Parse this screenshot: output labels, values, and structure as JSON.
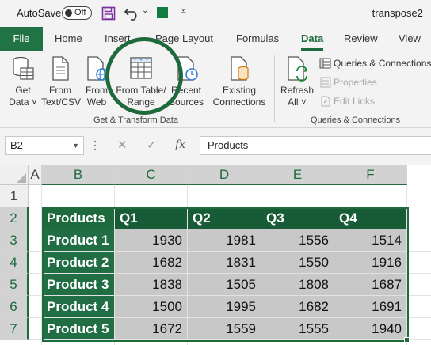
{
  "titlebar": {
    "autosave_label": "AutoSave",
    "autosave_state": "Off",
    "doc_title": "transpose2",
    "save_icon": "save-icon",
    "undo_icon": "undo-icon"
  },
  "tabs": [
    {
      "label": "File"
    },
    {
      "label": "Home"
    },
    {
      "label": "Insert"
    },
    {
      "label": "Page Layout"
    },
    {
      "label": "Formulas"
    },
    {
      "label": "Data"
    },
    {
      "label": "Review"
    },
    {
      "label": "View"
    }
  ],
  "ribbon": {
    "get_data": {
      "line1": "Get",
      "line2": "Data ˅"
    },
    "from_text_csv": {
      "line1": "From",
      "line2": "Text/CSV"
    },
    "from_web": {
      "line1": "From",
      "line2": "Web"
    },
    "from_table_range": {
      "line1": "From Table/",
      "line2": "Range"
    },
    "recent_sources": {
      "line1": "Recent",
      "line2": "Sources"
    },
    "existing_connections": {
      "line1": "Existing",
      "line2": "Connections"
    },
    "group_get_transform": "Get & Transform Data",
    "refresh_all": {
      "line1": "Refresh",
      "line2": "All ˅"
    },
    "queries_connections": "Queries & Connections",
    "properties": "Properties",
    "edit_links": "Edit Links",
    "group_queries": "Queries & Connections"
  },
  "formula_bar": {
    "name_box": "B2",
    "cancel_symbol": "✕",
    "enter_symbol": "✓",
    "fx_label": "fx",
    "formula_value": "Products"
  },
  "grid": {
    "columns": [
      "A",
      "B",
      "C",
      "D",
      "E",
      "F"
    ],
    "rows": [
      "1",
      "2",
      "3",
      "4",
      "5",
      "6",
      "7"
    ],
    "table_header": [
      "Products",
      "Q1",
      "Q2",
      "Q3",
      "Q4"
    ],
    "table_rows": [
      [
        "Product 1",
        "1930",
        "1981",
        "1556",
        "1514"
      ],
      [
        "Product 2",
        "1682",
        "1831",
        "1550",
        "1916"
      ],
      [
        "Product 3",
        "1838",
        "1505",
        "1808",
        "1687"
      ],
      [
        "Product 4",
        "1500",
        "1995",
        "1682",
        "1691"
      ],
      [
        "Product 5",
        "1672",
        "1559",
        "1555",
        "1940"
      ]
    ]
  },
  "colors": {
    "excel_green": "#217346",
    "table_header_green": "#185c37",
    "selection_fill": "#c8c8c8"
  }
}
